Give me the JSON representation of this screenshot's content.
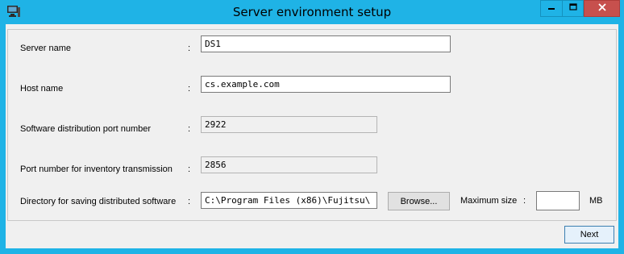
{
  "window": {
    "title": "Server environment setup",
    "accent_color": "#1fb3e6",
    "close_color": "#c7504d",
    "icons": {
      "app": "computer-icon",
      "minimize": "minimize-icon",
      "maximize": "maximize-icon",
      "close": "close-icon"
    }
  },
  "form": {
    "server_name": {
      "label": "Server name",
      "colon": ":",
      "value": "DS1"
    },
    "host_name": {
      "label": "Host name",
      "colon": ":",
      "value": "cs.example.com"
    },
    "distribution_port": {
      "label": "Software distribution port number",
      "colon": ":",
      "value": "2922"
    },
    "inventory_port": {
      "label": "Port number for inventory transmission",
      "colon": ":",
      "value": "2856"
    },
    "directory": {
      "label": "Directory for saving distributed software",
      "colon": ":",
      "value": "C:\\Program Files (x86)\\Fujitsu\\",
      "browse_label": "Browse...",
      "max_size_label": "Maximum size",
      "max_size_colon": ":",
      "max_size_value": "",
      "unit": "MB"
    }
  },
  "footer": {
    "next_label": "Next"
  }
}
